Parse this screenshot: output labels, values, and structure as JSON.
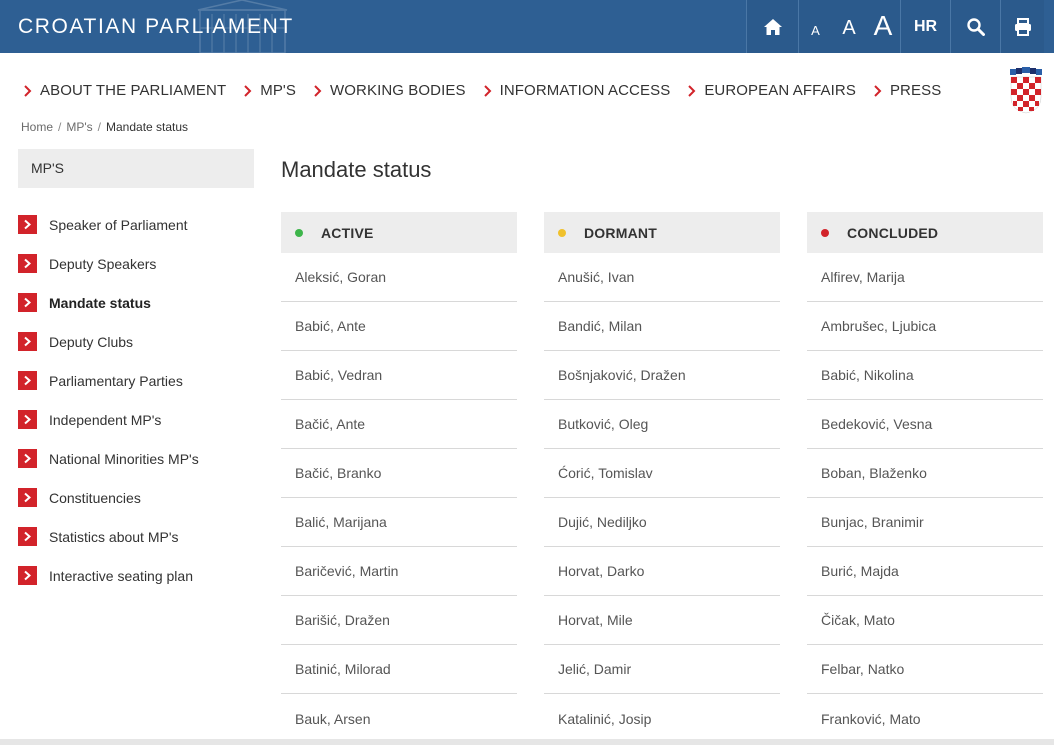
{
  "header": {
    "site_title": "CROATIAN PARLIAMENT",
    "tools": {
      "font_small": "A",
      "font_medium": "A",
      "font_large": "A",
      "language": "HR"
    },
    "icons": [
      "home-icon",
      "search-icon",
      "print-icon"
    ]
  },
  "nav": {
    "items": [
      {
        "label": "ABOUT THE PARLIAMENT"
      },
      {
        "label": "MP'S"
      },
      {
        "label": "WORKING BODIES"
      },
      {
        "label": "INFORMATION ACCESS"
      },
      {
        "label": "EUROPEAN AFFAIRS"
      },
      {
        "label": "PRESS"
      }
    ]
  },
  "breadcrumb": {
    "home": "Home",
    "section": "MP's",
    "current": "Mandate status"
  },
  "sidebar": {
    "heading": "MP'S",
    "items": [
      {
        "label": "Speaker of Parliament"
      },
      {
        "label": "Deputy Speakers"
      },
      {
        "label": "Mandate status"
      },
      {
        "label": "Deputy Clubs"
      },
      {
        "label": "Parliamentary Parties"
      },
      {
        "label": "Independent MP's"
      },
      {
        "label": "National Minorities MP's"
      },
      {
        "label": "Constituencies"
      },
      {
        "label": "Statistics about MP's"
      },
      {
        "label": "Interactive seating plan"
      }
    ]
  },
  "main": {
    "title": "Mandate status",
    "columns": [
      {
        "title": "ACTIVE",
        "color": "#3db54a",
        "members": [
          "Aleksić, Goran",
          "Babić, Ante",
          "Babić, Vedran",
          "Bačić, Ante",
          "Bačić, Branko",
          "Balić, Marijana",
          "Baričević, Martin",
          "Barišić, Dražen",
          "Batinić, Milorad",
          "Bauk, Arsen"
        ]
      },
      {
        "title": "DORMANT",
        "color": "#f0c12c",
        "members": [
          "Anušić, Ivan",
          "Bandić, Milan",
          "Bošnjaković, Dražen",
          "Butković, Oleg",
          "Ćorić, Tomislav",
          "Dujić, Nediljko",
          "Horvat, Darko",
          "Horvat, Mile",
          "Jelić, Damir",
          "Katalinić, Josip"
        ]
      },
      {
        "title": "CONCLUDED",
        "color": "#d2232a",
        "members": [
          "Alfirev, Marija",
          "Ambrušec, Ljubica",
          "Babić, Nikolina",
          "Bedeković, Vesna",
          "Boban, Blaženko",
          "Bunjac, Branimir",
          "Burić, Majda",
          "Čičak, Mato",
          "Felbar, Natko",
          "Franković, Mato"
        ]
      }
    ]
  },
  "colors": {
    "header_blue": "#2e5f93",
    "accent_red": "#d2232a",
    "panel_gray": "#ededed"
  }
}
